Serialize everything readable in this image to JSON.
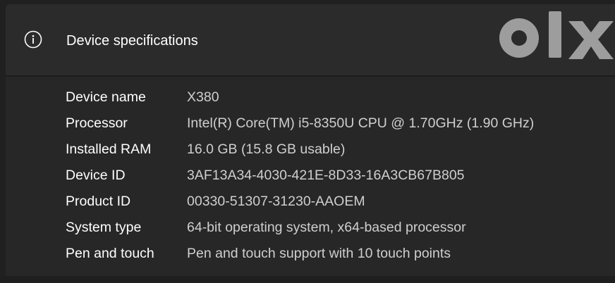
{
  "section": {
    "title": "Device specifications",
    "icon": "info-icon"
  },
  "watermark": {
    "icon": "olx-logo"
  },
  "specs": [
    {
      "label": "Device name",
      "value": "X380"
    },
    {
      "label": "Processor",
      "value": "Intel(R) Core(TM) i5-8350U CPU @ 1.70GHz (1.90 GHz)"
    },
    {
      "label": "Installed RAM",
      "value": "16.0 GB (15.8 GB usable)"
    },
    {
      "label": "Device ID",
      "value": "3AF13A34-4030-421E-8D33-16A3CB67B805"
    },
    {
      "label": "Product ID",
      "value": "00330-51307-31230-AAOEM"
    },
    {
      "label": "System type",
      "value": "64-bit operating system, x64-based processor"
    },
    {
      "label": "Pen and touch",
      "value": "Pen and touch support with 10 touch points"
    }
  ],
  "colors": {
    "background": "#202020",
    "panel": "#272727",
    "header": "#2b2b2b",
    "label_text": "#ffffff",
    "value_text": "#cfcfcf",
    "logo": "#b7b7b7"
  }
}
